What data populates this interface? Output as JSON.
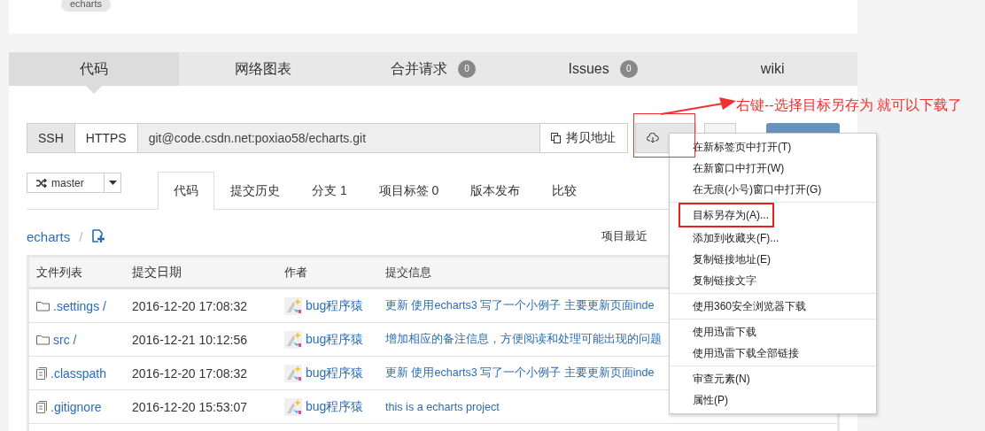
{
  "project_tag": "echarts",
  "tabs": [
    {
      "label": "代码",
      "selected": true
    },
    {
      "label": "网络图表",
      "selected": false
    },
    {
      "label": "合并请求",
      "count": "0",
      "selected": false
    },
    {
      "label": "Issues",
      "count": "0",
      "selected": false
    },
    {
      "label": "wiki",
      "selected": false
    }
  ],
  "clone": {
    "protocols": [
      {
        "label": "SSH",
        "selected": true
      },
      {
        "label": "HTTPS",
        "selected": false
      }
    ],
    "url": "git@code.csdn.net:poxiao58/echarts.git",
    "copy_button": "拷贝地址"
  },
  "branch": {
    "name": "master"
  },
  "subtabs": [
    {
      "label": "代码",
      "selected": true
    },
    {
      "label": "提交历史",
      "selected": false
    },
    {
      "label": "分支 1",
      "selected": false
    },
    {
      "label": "项目标签 0",
      "selected": false
    },
    {
      "label": "版本发布",
      "selected": false
    },
    {
      "label": "比较",
      "selected": false
    }
  ],
  "breadcrumb": "echarts",
  "separator": "/",
  "recent_label": "项目最近",
  "table": {
    "columns": [
      "文件列表",
      "提交日期",
      "作者",
      "提交信息"
    ],
    "rows": [
      {
        "kind": "folder",
        "name": ".settings /",
        "date": "2016-12-20 17:08:32",
        "author": "bug程序猿",
        "message": "更新 使用echarts3 写了一个小例子 主要更新页面inde"
      },
      {
        "kind": "folder",
        "name": "src /",
        "date": "2016-12-21 10:12:56",
        "author": "bug程序猿",
        "message": "增加相应的备注信息，方便阅读和处理可能出现的问题"
      },
      {
        "kind": "file",
        "name": ".classpath",
        "date": "2016-12-20 17:08:32",
        "author": "bug程序猿",
        "message": "更新 使用echarts3 写了一个小例子 主要更新页面inde"
      },
      {
        "kind": "file",
        "name": ".gitignore",
        "date": "2016-12-20 15:53:07",
        "author": "bug程序猿",
        "message": "this is a echarts project"
      }
    ]
  },
  "context_menu": [
    [
      {
        "label": "在新标签页中打开(T)",
        "annotated": false
      },
      {
        "label": "在新窗口中打开(W)",
        "annotated": false
      },
      {
        "label": "在无痕(小号)窗口中打开(G)",
        "annotated": false
      }
    ],
    [
      {
        "label": "目标另存为(A)...",
        "annotated": true
      },
      {
        "label": "添加到收藏夹(F)...",
        "annotated": false
      },
      {
        "label": "复制链接地址(E)",
        "annotated": false
      },
      {
        "label": "复制链接文字",
        "annotated": false
      }
    ],
    [
      {
        "label": "使用360安全浏览器下载",
        "annotated": false
      }
    ],
    [
      {
        "label": "使用迅雷下载",
        "annotated": false
      },
      {
        "label": "使用迅雷下载全部链接",
        "annotated": false
      }
    ],
    [
      {
        "label": "审查元素(N)",
        "annotated": false
      },
      {
        "label": "属性(P)",
        "annotated": false
      }
    ]
  ],
  "annotation": "右键--选择目标另存为 就可以下载了"
}
